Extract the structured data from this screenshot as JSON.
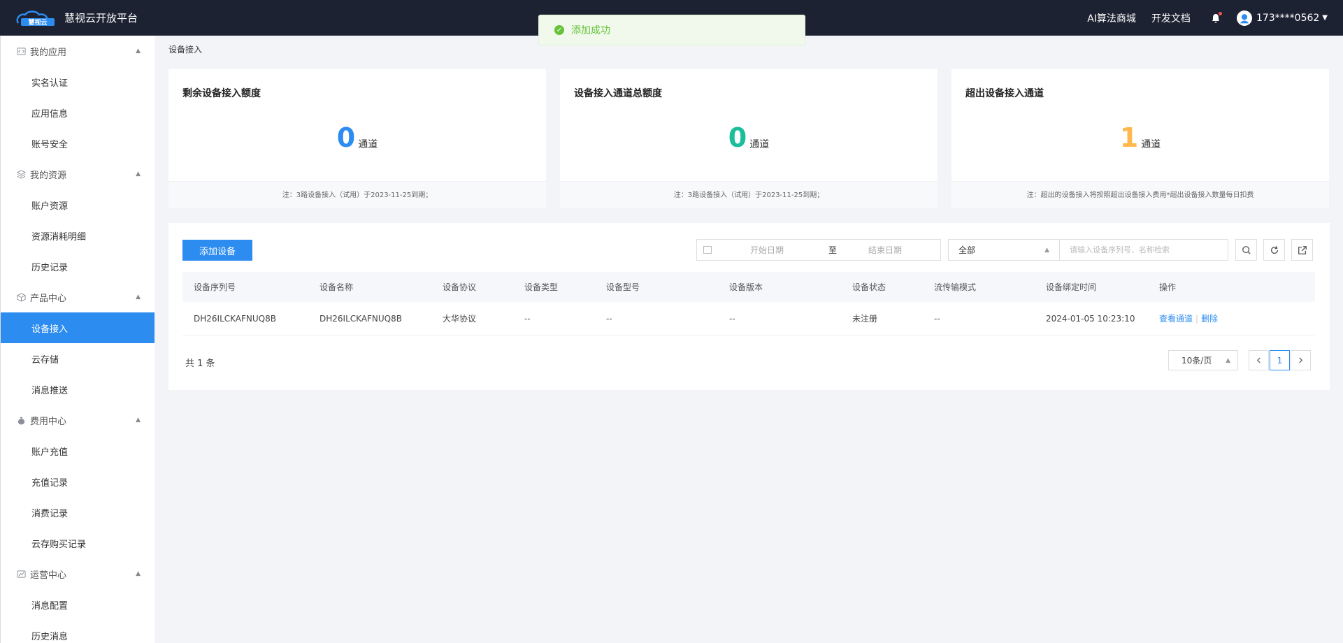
{
  "header": {
    "logo_text": "慧视云",
    "title": "慧视云开放平台",
    "links": [
      "AI算法商城",
      "开发文档"
    ],
    "user": "173****0562"
  },
  "toast": {
    "message": "添加成功"
  },
  "sidebar": {
    "groups": [
      {
        "label": "我的应用",
        "icon": "code-icon",
        "items": [
          "实名认证",
          "应用信息",
          "账号安全"
        ]
      },
      {
        "label": "我的资源",
        "icon": "layers-icon",
        "items": [
          "账户资源",
          "资源消耗明细",
          "历史记录"
        ]
      },
      {
        "label": "产品中心",
        "icon": "cube-icon",
        "items": [
          "设备接入",
          "云存储",
          "消息推送"
        ]
      },
      {
        "label": "费用中心",
        "icon": "money-bag-icon",
        "items": [
          "账户充值",
          "充值记录",
          "消费记录",
          "云存购买记录"
        ]
      },
      {
        "label": "运营中心",
        "icon": "chart-icon",
        "items": [
          "消息配置",
          "历史消息"
        ]
      }
    ],
    "active_item": "设备接入"
  },
  "breadcrumb": "设备接入",
  "stats": [
    {
      "title": "剩余设备接入额度",
      "value": "0",
      "unit": "通道",
      "color": "#2d8cf0",
      "note": "注：3路设备接入（试用）于2023-11-25到期；"
    },
    {
      "title": "设备接入通道总额度",
      "value": "0",
      "unit": "通道",
      "color": "#19be9b",
      "note": "注：3路设备接入（试用）于2023-11-25到期；"
    },
    {
      "title": "超出设备接入通道",
      "value": "1",
      "unit": "通道",
      "color": "#ffb84d",
      "note": "注：超出的设备接入将按照超出设备接入费用*超出设备接入数量每日扣费"
    }
  ],
  "toolbar": {
    "add_label": "添加设备",
    "start_placeholder": "开始日期",
    "to_label": "至",
    "end_placeholder": "结束日期",
    "select_value": "全部",
    "search_placeholder": "请输入设备序列号、名称检索"
  },
  "table": {
    "headers": [
      "设备序列号",
      "设备名称",
      "设备协议",
      "设备类型",
      "设备型号",
      "设备版本",
      "设备状态",
      "流传输模式",
      "设备绑定时间",
      "操作"
    ],
    "rows": [
      [
        "DH26ILCKAFNUQ8B",
        "DH26ILCKAFNUQ8B",
        "大华协议",
        "--",
        "--",
        "--",
        "未注册",
        "--",
        "2024-01-05 10:23:10"
      ]
    ],
    "actions": [
      "查看通道",
      "删除"
    ]
  },
  "pagination": {
    "total": "共 1 条",
    "page_size": "10条/页",
    "current": "1"
  }
}
